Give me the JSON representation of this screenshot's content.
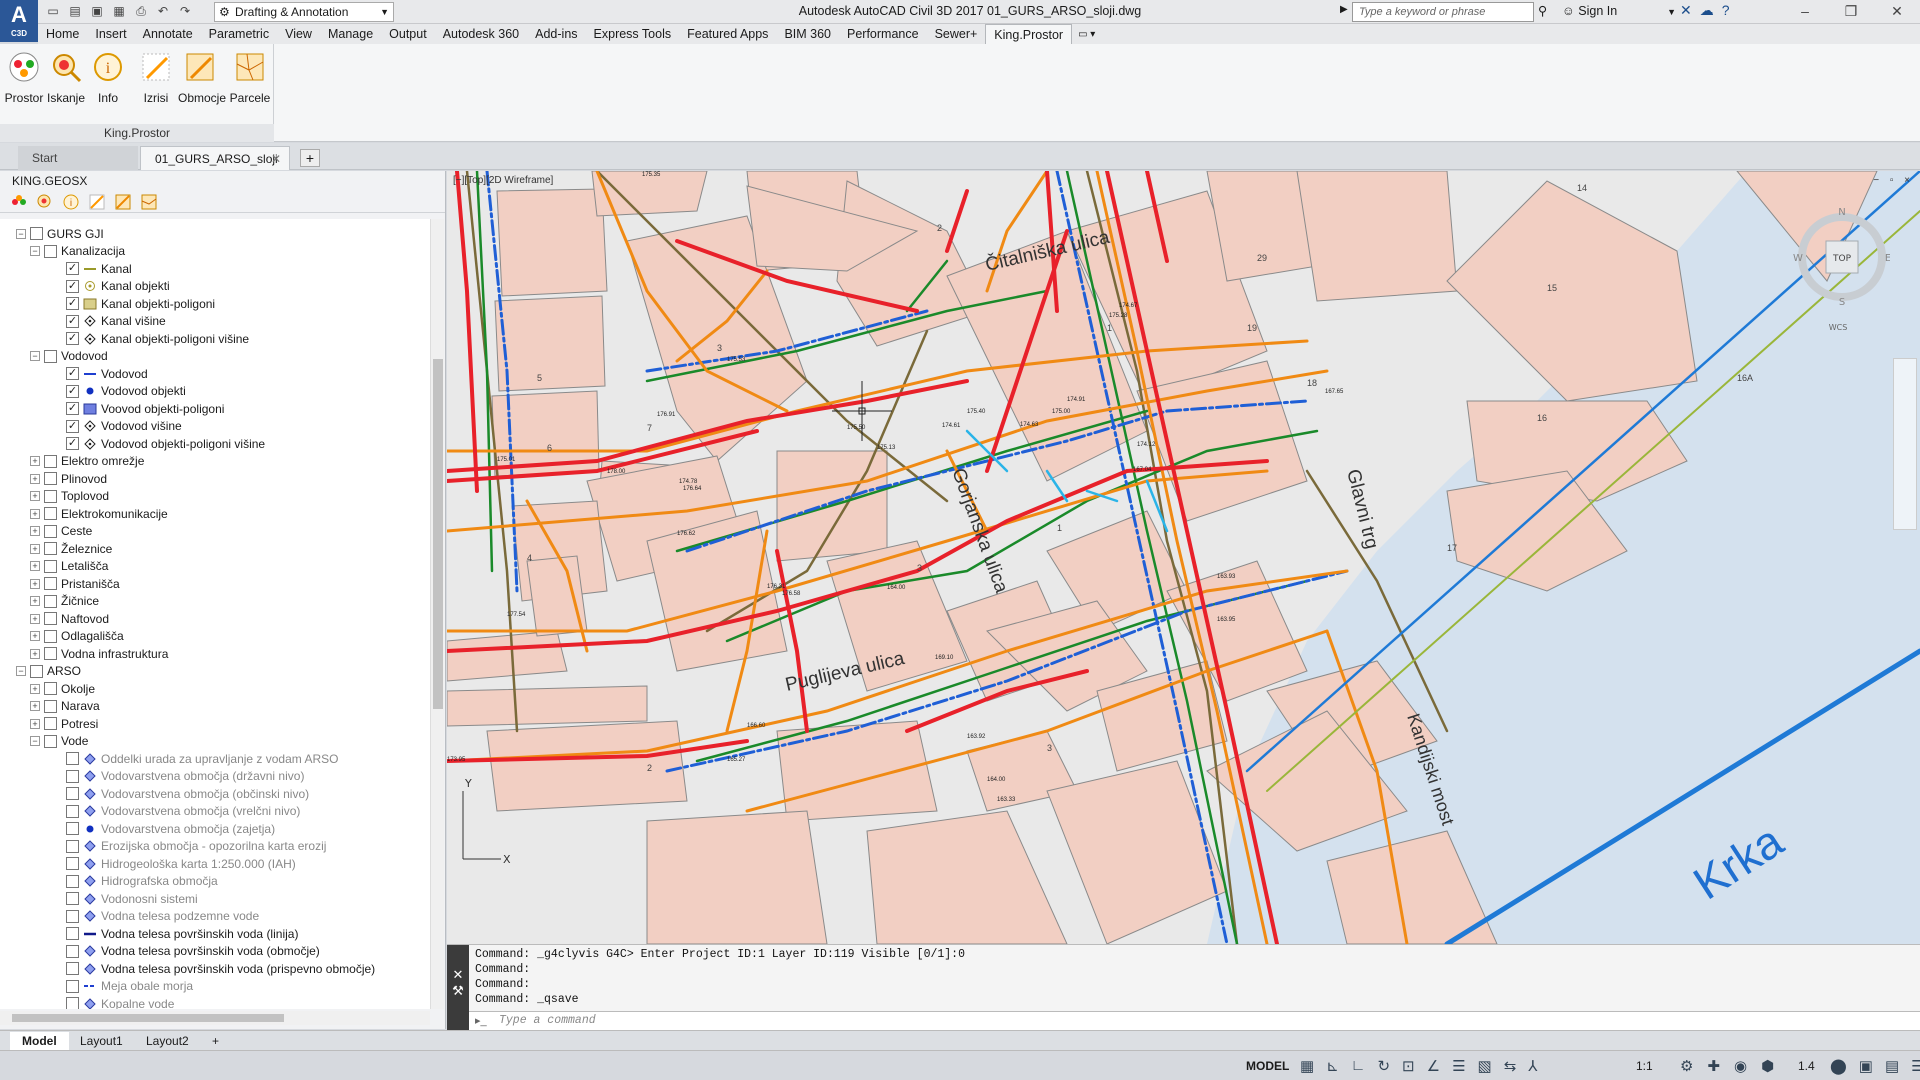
{
  "app": {
    "logo": "A",
    "logo_sub": "C3D",
    "workspace": "Drafting & Annotation",
    "window_title": "Autodesk AutoCAD Civil 3D 2017   01_GURS_ARSO_sloji.dwg",
    "search_placeholder": "Type a keyword or phrase",
    "signin": "Sign In"
  },
  "ribbon_tabs": [
    "Home",
    "Insert",
    "Annotate",
    "Parametric",
    "View",
    "Manage",
    "Output",
    "Autodesk 360",
    "Add-ins",
    "Express Tools",
    "Featured Apps",
    "BIM 360",
    "Performance",
    "Sewer+",
    "King.Prostor"
  ],
  "ribbon": {
    "buttons": [
      "Prostor",
      "Iskanje",
      "Info",
      "Izrisi",
      "Obmocje",
      "Parcele"
    ],
    "panel_title": "King.Prostor"
  },
  "doc_tabs": {
    "start": "Start",
    "active": "01_GURS_ARSO_sloji"
  },
  "palette": {
    "title": "KING.GEOSX",
    "tree": [
      {
        "label": "GURS GJI",
        "level": 1,
        "exp": "−",
        "cb": ""
      },
      {
        "label": "Kanalizacija",
        "level": 2,
        "exp": "−",
        "cb": ""
      },
      {
        "label": "Kanal",
        "level": 3,
        "cb": "✓",
        "icon": "line-olive"
      },
      {
        "label": "Kanal objekti",
        "level": 3,
        "cb": "✓",
        "icon": "circle-olive"
      },
      {
        "label": "Kanal objekti-poligoni",
        "level": 3,
        "cb": "✓",
        "icon": "hatch-olive"
      },
      {
        "label": "Kanal višine",
        "level": 3,
        "cb": "✓",
        "icon": "diamond"
      },
      {
        "label": "Kanal objekti-poligoni višine",
        "level": 3,
        "cb": "✓",
        "icon": "diamond"
      },
      {
        "label": "Vodovod",
        "level": 2,
        "exp": "−",
        "cb": ""
      },
      {
        "label": "Vodovod",
        "level": 3,
        "cb": "✓",
        "icon": "line-blue"
      },
      {
        "label": "Vodovod objekti",
        "level": 3,
        "cb": "✓",
        "icon": "dot-blue"
      },
      {
        "label": "Voovod objekti-poligoni",
        "level": 3,
        "cb": "✓",
        "icon": "hatch-blue"
      },
      {
        "label": "Vodovod višine",
        "level": 3,
        "cb": "✓",
        "icon": "diamond"
      },
      {
        "label": "Vodovod objekti-poligoni višine",
        "level": 3,
        "cb": "✓",
        "icon": "diamond"
      },
      {
        "label": "Elektro omrežje",
        "level": 2,
        "exp": "+",
        "cb": ""
      },
      {
        "label": "Plinovod",
        "level": 2,
        "exp": "+",
        "cb": ""
      },
      {
        "label": "Toplovod",
        "level": 2,
        "exp": "+",
        "cb": ""
      },
      {
        "label": "Elektrokomunikacije",
        "level": 2,
        "exp": "+",
        "cb": ""
      },
      {
        "label": "Ceste",
        "level": 2,
        "exp": "+",
        "cb": ""
      },
      {
        "label": "Železnice",
        "level": 2,
        "exp": "+",
        "cb": ""
      },
      {
        "label": "Letališča",
        "level": 2,
        "exp": "+",
        "cb": ""
      },
      {
        "label": "Pristanišča",
        "level": 2,
        "exp": "+",
        "cb": ""
      },
      {
        "label": "Žičnice",
        "level": 2,
        "exp": "+",
        "cb": ""
      },
      {
        "label": "Naftovod",
        "level": 2,
        "exp": "+",
        "cb": ""
      },
      {
        "label": "Odlagališča",
        "level": 2,
        "exp": "+",
        "cb": ""
      },
      {
        "label": "Vodna infrastruktura",
        "level": 2,
        "exp": "+",
        "cb": ""
      },
      {
        "label": "ARSO",
        "level": 1,
        "exp": "−",
        "cb": ""
      },
      {
        "label": "Okolje",
        "level": 2,
        "exp": "+",
        "cb": ""
      },
      {
        "label": "Narava",
        "level": 2,
        "exp": "+",
        "cb": ""
      },
      {
        "label": "Potresi",
        "level": 2,
        "exp": "+",
        "cb": ""
      },
      {
        "label": "Vode",
        "level": 2,
        "exp": "−",
        "cb": ""
      },
      {
        "label": "Oddelki urada za upravljanje z vodam ARSO",
        "level": 3,
        "cb": "",
        "icon": "diamond-blue",
        "dim": true
      },
      {
        "label": "Vodovarstvena območja (državni nivo)",
        "level": 3,
        "cb": "",
        "icon": "diamond-blue",
        "dim": true
      },
      {
        "label": "Vodovarstvena območja (občinski nivo)",
        "level": 3,
        "cb": "",
        "icon": "diamond-blue",
        "dim": true
      },
      {
        "label": "Vodovarstvena območja (vrelčni nivo)",
        "level": 3,
        "cb": "",
        "icon": "diamond-blue",
        "dim": true
      },
      {
        "label": "Vodovarstvena območja (zajetja)",
        "level": 3,
        "cb": "",
        "icon": "dot-blue",
        "dim": true
      },
      {
        "label": "Erozijska območja - opozorilna karta erozij",
        "level": 3,
        "cb": "",
        "icon": "diamond-blue",
        "dim": true
      },
      {
        "label": "Hidrogeološka karta 1:250.000 (IAH)",
        "level": 3,
        "cb": "",
        "icon": "diamond-blue",
        "dim": true
      },
      {
        "label": "Hidrografska območja",
        "level": 3,
        "cb": "",
        "icon": "diamond-blue",
        "dim": true
      },
      {
        "label": "Vodonosni sistemi",
        "level": 3,
        "cb": "",
        "icon": "diamond-blue",
        "dim": true
      },
      {
        "label": "Vodna telesa podzemne vode",
        "level": 3,
        "cb": "",
        "icon": "diamond-blue",
        "dim": true
      },
      {
        "label": "Vodna telesa površinskih voda (linija)",
        "level": 3,
        "cb": "",
        "icon": "line-navy"
      },
      {
        "label": "Vodna telesa površinskih voda (območje)",
        "level": 3,
        "cb": "",
        "icon": "diamond-blue"
      },
      {
        "label": "Vodna telesa površinskih voda (prispevno območje)",
        "level": 3,
        "cb": "",
        "icon": "diamond-blue"
      },
      {
        "label": "Meja obale morja",
        "level": 3,
        "cb": "",
        "icon": "dash-blue",
        "dim": true
      },
      {
        "label": "Kopalne vode",
        "level": 3,
        "cb": "",
        "icon": "diamond-blue",
        "dim": true
      }
    ]
  },
  "viewport": {
    "label": "[−][Top][2D Wireframe]",
    "controls": "− ▫ ×",
    "viewcube": {
      "top": "TOP",
      "n": "N",
      "s": "S",
      "e": "E",
      "w": "W",
      "wcs": "WCS"
    }
  },
  "map": {
    "streets": [
      "Čitalniška ulica",
      "Glavni trg",
      "Puglijeva ulica",
      "Kandijski most",
      "Krka",
      "Gorjanska ulica"
    ],
    "parcel_numbers": [
      "2",
      "3",
      "4",
      "5",
      "6",
      "7",
      "14",
      "15",
      "16",
      "16A",
      "18",
      "19",
      "29",
      "1",
      "1",
      "2",
      "3",
      "3",
      "17"
    ],
    "elevations": [
      "175.35",
      "176.91",
      "175.01",
      "178.00",
      "174.78",
      "176.64",
      "175.53",
      "176.62",
      "175.13",
      "175.50",
      "174.61",
      "174.91",
      "175.40",
      "174.67",
      "175.28",
      "174.12",
      "167.04",
      "167.65",
      "163.93",
      "163.95",
      "163.92",
      "164.00",
      "163.33",
      "164.00",
      "165.27",
      "166.60",
      "177.54",
      "176.58",
      "176.31",
      "169.10",
      "174.63",
      "175.00",
      "173.95"
    ]
  },
  "command": {
    "history": [
      "Command: _g4clyvis G4C> Enter Project ID:1  Layer ID:119  Visible [0/1]:0",
      "Command:",
      "Command:",
      "Command: _qsave"
    ],
    "prompt_icon": "▸_",
    "placeholder": "Type a command"
  },
  "layout_tabs": [
    "Model",
    "Layout1",
    "Layout2"
  ],
  "status": {
    "mode": "MODEL",
    "scale": "1:1",
    "zoom": "1.4"
  },
  "colors": {
    "parcel_fill": "#f2cfc3",
    "parcel_stroke": "#8a8a8a",
    "river": "#d4e1ee",
    "gas": "#e8212a",
    "water": "#1f5fd6",
    "sewer": "#1a8a2a",
    "power": "#f08a14",
    "telecom": "#7a6a3a"
  }
}
